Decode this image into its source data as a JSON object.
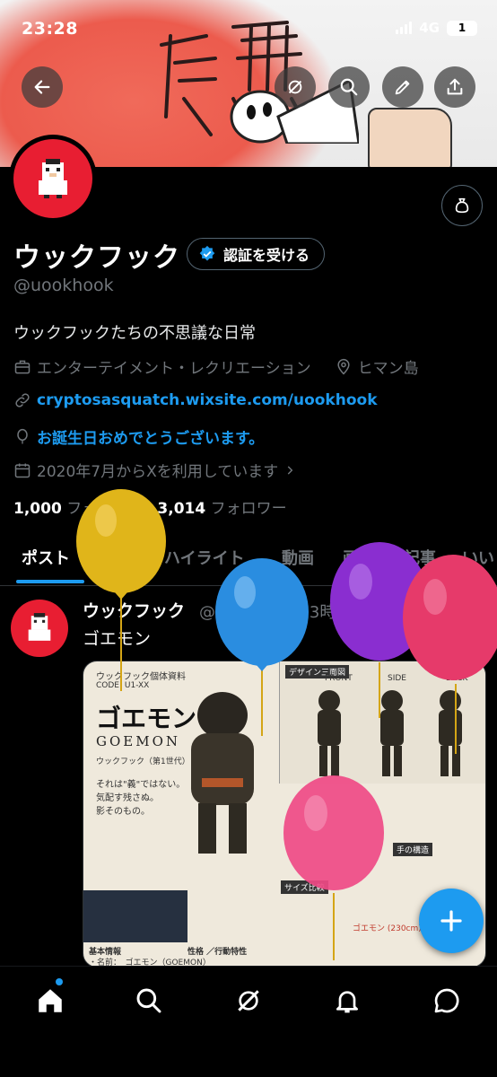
{
  "status_bar": {
    "time": "23:28",
    "network": "4G",
    "battery": "1"
  },
  "banner": {
    "text": "虚無"
  },
  "header_icons": [
    "back-arrow-icon",
    "grok-icon",
    "search-icon",
    "edit-icon",
    "share-icon"
  ],
  "profile": {
    "name": "ウックフック",
    "verify_label": "認証を受ける",
    "handle": "@uookhook",
    "bio": "ウックフックたちの不思議な日常",
    "category": "エンターテイメント・レクリエーション",
    "location": "ヒマン島",
    "website": "cryptosasquatch.wixsite.com/uookhook",
    "birthday": "お誕生日おめでとうございます。",
    "joined": "2020年7月からXを利用しています",
    "following_count": "1,000",
    "following_label": "フォロー中",
    "followers_count": "3,014",
    "followers_label": "フォロワー"
  },
  "tabs": [
    "ポスト",
    "返信",
    "ハイライト",
    "動画",
    "画像",
    "記事",
    "いい"
  ],
  "active_tab": 0,
  "post": {
    "author": "ウックフック",
    "handle": "@uookhook",
    "time": "3時間",
    "text": "ゴエモン",
    "media": {
      "header": "ウックフック個体資料",
      "code": "CODE: U1-XX",
      "title": "ゴエモン",
      "roman": "GOEMON",
      "subtitle": "ウックフック（第1世代）",
      "quote1": "それは\"義\"ではない。",
      "quote2": "気配す残さぬ。",
      "quote3": "影そのもの。",
      "design_label": "デザイン三面図",
      "front": "FRONT",
      "side": "SIDE",
      "back": "BACK",
      "basic_info": "基本情報",
      "personality": "性格 ／行動特性",
      "hands": "手の構造",
      "compare": "サイズ比較",
      "size_value": "ゴエモン (230cm)",
      "info_name": "・名前：　ゴエモン（GOEMON）"
    }
  },
  "balloon_colors": [
    "#e0b51a",
    "#2a8de0",
    "#8a2ed0",
    "#e63a6a",
    "#ef4a86"
  ],
  "bottom_nav": [
    "home-icon",
    "search-icon",
    "grok-icon",
    "notifications-icon",
    "messages-icon"
  ]
}
